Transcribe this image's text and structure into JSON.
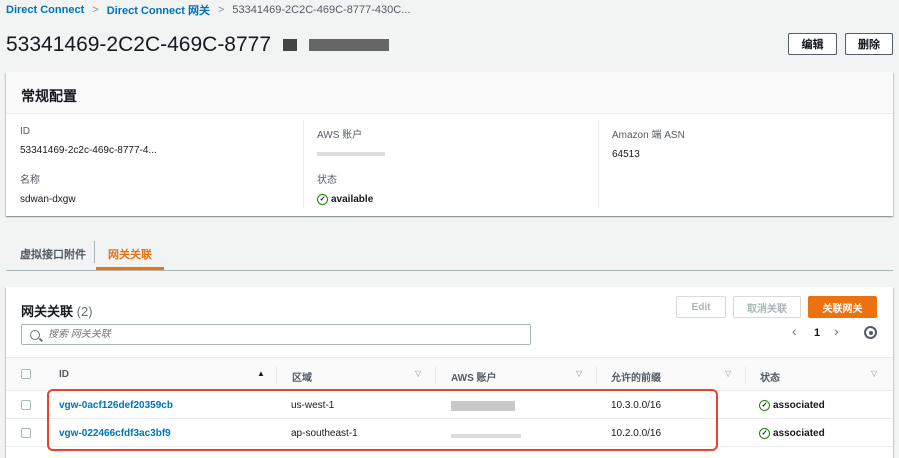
{
  "breadcrumb": {
    "items": [
      "Direct Connect",
      "Direct Connect 网关"
    ],
    "current": "53341469-2C2C-469C-8777-430C..."
  },
  "page": {
    "title": "53341469-2C2C-469C-8777",
    "edit_label": "编辑",
    "delete_label": "删除"
  },
  "general": {
    "header": "常规配置",
    "id_label": "ID",
    "id_value": "53341469-2c2c-469c-8777-4...",
    "account_label": "AWS 账户",
    "asn_label": "Amazon 端 ASN",
    "asn_value": "64513",
    "name_label": "名称",
    "name_value": "sdwan-dxgw",
    "status_label": "状态",
    "status_value": "available"
  },
  "tabs": [
    "虚拟接口附件",
    "网关关联"
  ],
  "associations": {
    "title": "网关关联",
    "count": "(2)",
    "edit_label": "Edit",
    "disassociate_label": "取消关联",
    "associate_label": "关联网关",
    "search_placeholder": "搜索 网关关联",
    "page_number": "1",
    "columns": [
      "ID",
      "区域",
      "AWS 账户",
      "允许的前缀",
      "状态"
    ],
    "rows": [
      {
        "id": "vgw-0acf126def20359cb",
        "region": "us-west-1",
        "prefix": "10.3.0.0/16",
        "status": "associated"
      },
      {
        "id": "vgw-022466cfdf3ac3bf9",
        "region": "ap-southeast-1",
        "prefix": "10.2.0.0/16",
        "status": "associated"
      }
    ]
  },
  "colors": {
    "link": "#0073bb",
    "primary": "#ec7211",
    "success": "#1d8102",
    "highlight": "#e6452b"
  }
}
